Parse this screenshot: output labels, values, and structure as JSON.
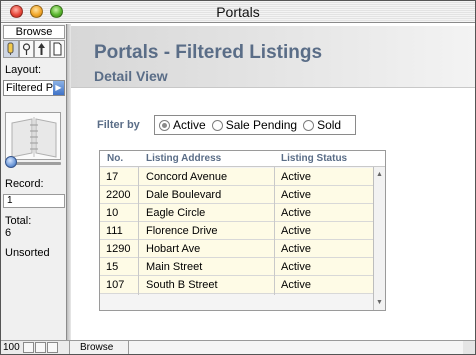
{
  "window": {
    "title": "Portals"
  },
  "status_area": {
    "mode": "Browse",
    "tools": [
      {
        "icon": "browse-tool-icon"
      },
      {
        "icon": "find-tool-icon"
      },
      {
        "icon": "layout-tool-icon"
      },
      {
        "icon": "preview-tool-icon"
      }
    ],
    "layout_label": "Layout:",
    "layout_value": "Filtered P",
    "book_icon": "book-icon",
    "record_label": "Record:",
    "record_value": "1",
    "total_label": "Total:",
    "total_value": "6",
    "sort_status": "Unsorted"
  },
  "header": {
    "title": "Portals - Filtered Listings",
    "subtitle": "Detail View"
  },
  "filter": {
    "label": "Filter by",
    "options": [
      {
        "label": "Active",
        "checked": true
      },
      {
        "label": "Sale Pending",
        "checked": false
      },
      {
        "label": "Sold",
        "checked": false
      }
    ]
  },
  "portal": {
    "columns": [
      "No.",
      "Listing Address",
      "Listing Status"
    ],
    "rows": [
      {
        "no": "17",
        "address": "Concord Avenue",
        "status": "Active"
      },
      {
        "no": "2200",
        "address": "Dale Boulevard",
        "status": "Active"
      },
      {
        "no": "10",
        "address": "Eagle Circle",
        "status": "Active"
      },
      {
        "no": "111",
        "address": "Florence Drive",
        "status": "Active"
      },
      {
        "no": "1290",
        "address": "Hobart Ave",
        "status": "Active"
      },
      {
        "no": "15",
        "address": "Main Street",
        "status": "Active"
      },
      {
        "no": "107",
        "address": "South B Street",
        "status": "Active"
      }
    ]
  },
  "bottom_bar": {
    "zoom": "100",
    "mode": "Browse"
  },
  "colors": {
    "accent_text": "#5a6d87",
    "row_fill": "#fefbe6"
  }
}
